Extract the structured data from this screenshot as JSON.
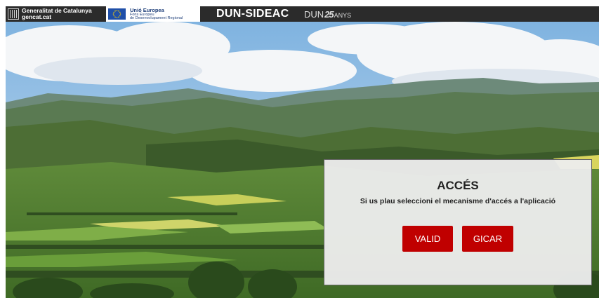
{
  "header": {
    "gencat_line1": "Generalitat de Catalunya",
    "gencat_line2": "gencat.cat",
    "eu_line1": "Unió Europea",
    "eu_line2": "Fons Europeu",
    "eu_line3": "de Desenvolupament Regional",
    "app_title": "DUN-SIDEAC",
    "anniv_prefix": "DUN",
    "anniv_number": "25",
    "anniv_suffix": "ANYS"
  },
  "dialog": {
    "title": "ACCÉS",
    "subtitle": "Si us plau seleccioni el mecanisme d'accés a l'aplicació",
    "buttons": [
      {
        "label": "VALID"
      },
      {
        "label": "GICAR"
      }
    ]
  },
  "colors": {
    "topbar": "#2b2b2b",
    "button": "#c00000",
    "eu_flag": "#1f4fa8"
  }
}
